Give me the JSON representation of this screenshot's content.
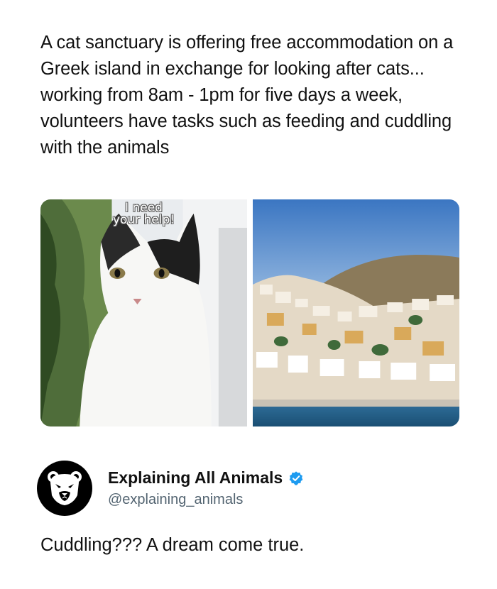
{
  "post": {
    "headline": "A cat sanctuary is offering free accommodation on a Greek island in exchange for looking after cats... working from 8am - 1pm for five days a week, volunteers have tasks such as feeding and cuddling with the animals",
    "meme_caption": [
      "I need",
      "your help!"
    ]
  },
  "profile": {
    "display_name": "Explaining All Animals",
    "handle": "@explaining_animals",
    "avatar_icon": "bear-icon",
    "verified_icon": "verified-badge-icon",
    "verified_color": "#1d9bf0"
  },
  "reply": {
    "text": "Cuddling??? A dream come true."
  }
}
